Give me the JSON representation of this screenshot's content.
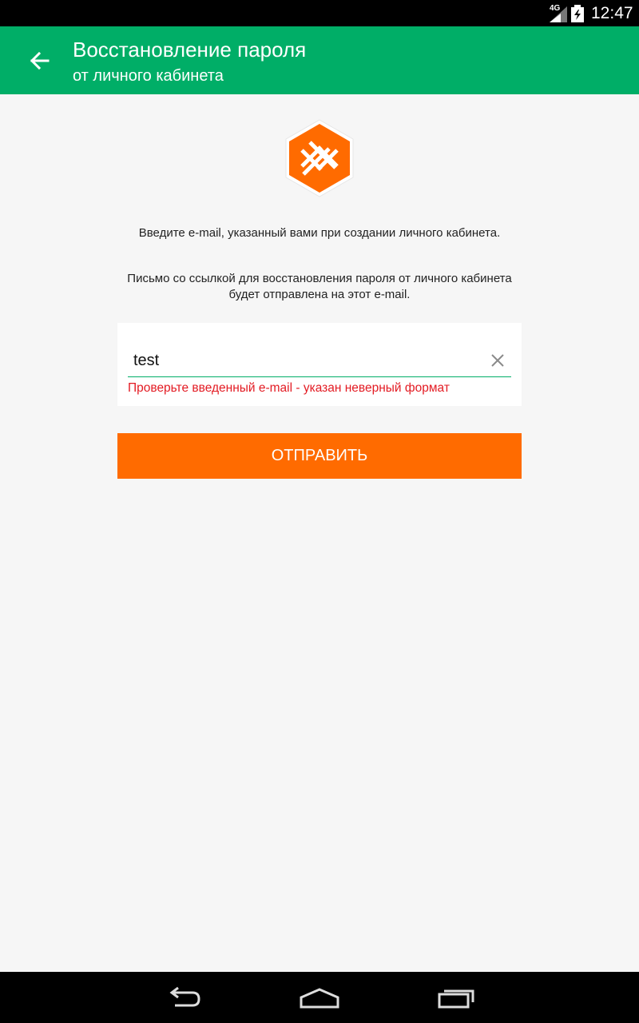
{
  "status_bar": {
    "network": "4G",
    "time": "12:47"
  },
  "app_bar": {
    "title": "Восстановление пароля",
    "subtitle": "от личного кабинета",
    "back_icon": "arrow-back-icon"
  },
  "logo": {
    "icon": "hexagon-pattern-logo",
    "color": "#ff6b00"
  },
  "content": {
    "instruction": "Введите e-mail, указанный вами при создании личного кабинета.",
    "note": "Письмо со ссылкой для восстановления пароля от личного кабинета будет отправлена на этот e-mail."
  },
  "form": {
    "email_value": "test",
    "clear_icon": "close-icon",
    "error": "Проверьте введенный e-mail - указан неверный формат"
  },
  "submit": {
    "label": "ОТПРАВИТЬ"
  },
  "nav_bar": {
    "back_icon": "nav-back-icon",
    "home_icon": "nav-home-icon",
    "recents_icon": "nav-recents-icon"
  },
  "colors": {
    "primary": "#00ae67",
    "accent": "#ff6b00",
    "error": "#e31b23",
    "background": "#f6f6f6"
  }
}
